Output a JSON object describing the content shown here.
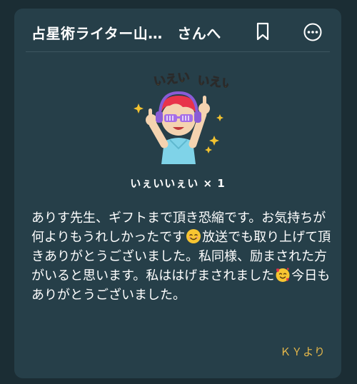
{
  "header": {
    "title": "占星術ライター山…　さんへ",
    "bookmark_icon": "bookmark-icon",
    "more_icon": "more-options-icon"
  },
  "sticker": {
    "name": "iei-iei-sticker",
    "text_left": "いえい",
    "text_right": "いえい"
  },
  "gift": {
    "label": "いぇいいぇい × 1"
  },
  "message": {
    "part1": "ありす先生、ギフトまで頂き恐縮です。お気持ちが何よりもうれしかったです",
    "emoji1": "smiling-face-icon",
    "part2": "放送でも取り上げて頂きありがとうございました。私同様、励まされた方がいると思います。私ははげまされました",
    "emoji2": "smiling-face-with-hearts-icon",
    "part3": "今日もありがとうございました。"
  },
  "sender": {
    "label": "ＫＹより"
  },
  "colors": {
    "background": "#1b2d34",
    "card": "#263f49",
    "text": "#ffffff",
    "sender": "#e6b84a",
    "sticker_text": "#f2c230"
  }
}
